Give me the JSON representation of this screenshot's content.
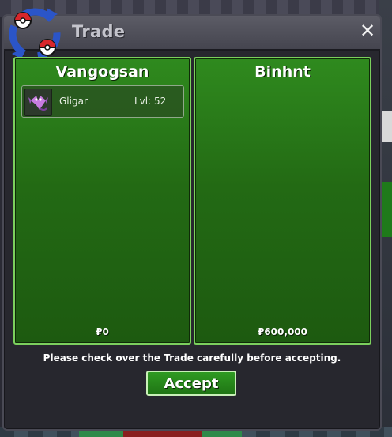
{
  "window": {
    "title": "Trade",
    "close_symbol": "✕"
  },
  "panels": [
    {
      "player": "Vangogsan",
      "money": "₽0",
      "items": [
        {
          "pokemon": "Gligar",
          "level": "Lvl: 52",
          "icon": "gligar-sprite-icon"
        }
      ]
    },
    {
      "player": "Binhnt",
      "money": "₽600,000",
      "items": []
    }
  ],
  "footer": {
    "notice": "Please check over the Trade carefully before accepting.",
    "accept_label": "Accept"
  },
  "colors": {
    "panel_green": "#2f8a1e",
    "panel_border": "#7bd05d",
    "titlebar": "#55555f"
  }
}
